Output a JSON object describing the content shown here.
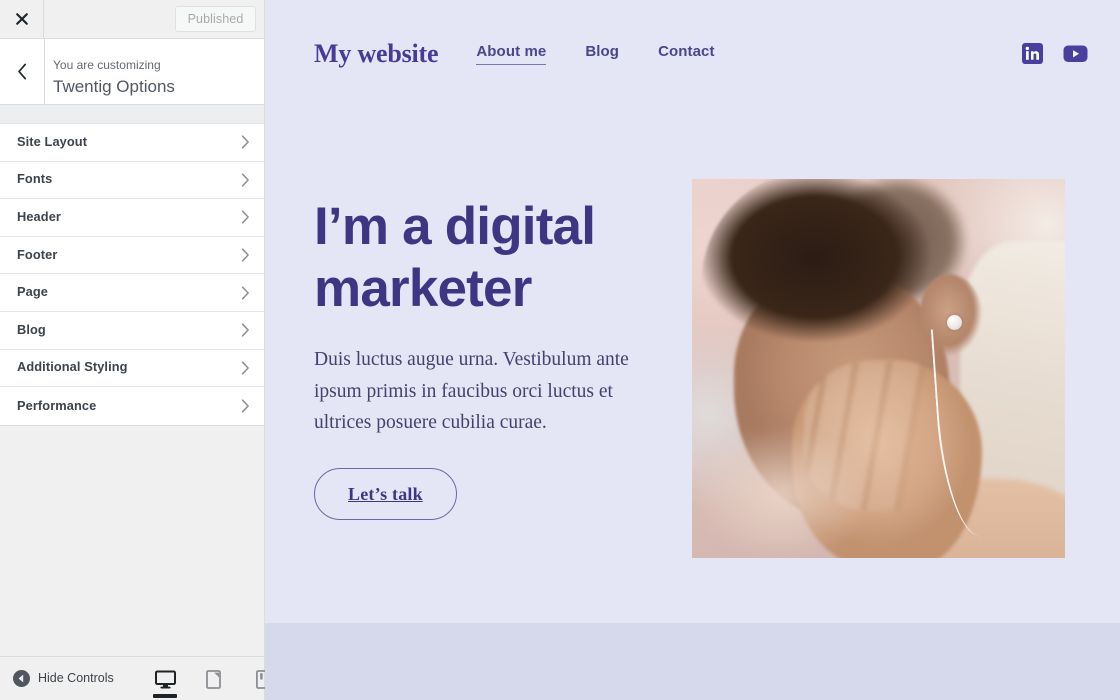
{
  "customizer": {
    "close_icon": "close-icon",
    "published_label": "Published",
    "back_icon": "chevron-left-icon",
    "eyebrow": "You are customizing",
    "panel_title": "Twentig Options",
    "menu_items": [
      {
        "label": "Site Layout",
        "icon": "chevron-right-icon"
      },
      {
        "label": "Fonts",
        "icon": "chevron-right-icon"
      },
      {
        "label": "Header",
        "icon": "chevron-right-icon"
      },
      {
        "label": "Footer",
        "icon": "chevron-right-icon"
      },
      {
        "label": "Page",
        "icon": "chevron-right-icon"
      },
      {
        "label": "Blog",
        "icon": "chevron-right-icon"
      },
      {
        "label": "Additional Styling",
        "icon": "chevron-right-icon"
      },
      {
        "label": "Performance",
        "icon": "chevron-right-icon"
      }
    ],
    "bottom": {
      "hide_controls_label": "Hide Controls",
      "hide_controls_icon": "collapse-left-circle-icon",
      "devices": [
        {
          "name": "desktop",
          "icon": "desktop-icon",
          "active": true
        },
        {
          "name": "tablet",
          "icon": "tablet-icon",
          "active": false
        },
        {
          "name": "mobile",
          "icon": "mobile-icon",
          "active": false
        }
      ]
    }
  },
  "site": {
    "brand": "My website",
    "nav": [
      {
        "label": "About me",
        "active": true
      },
      {
        "label": "Blog",
        "active": false
      },
      {
        "label": "Contact",
        "active": false
      }
    ],
    "social": [
      {
        "name": "linkedin-icon",
        "label": "in"
      },
      {
        "name": "youtube-icon",
        "label": "play"
      }
    ],
    "hero": {
      "heading": "I’m a digital marketer",
      "paragraph": "Duis luctus augue urna. Vestibulum ante ipsum primis in faucibus orci luctus et ultrices posuere cubilia curae.",
      "button_label": "Let’s talk",
      "image_alt": "Person with earphones resting hand on face"
    }
  },
  "colors": {
    "hero_background": "#e5e6f5",
    "lower_band": "#d6d8ec",
    "brand_purple": "#483a96",
    "heading_purple": "#3e3683",
    "body_text": "#45406e",
    "sidebar_background": "#f0f0f1",
    "panel_white": "#ffffff",
    "published_text": "#a7aaad"
  }
}
